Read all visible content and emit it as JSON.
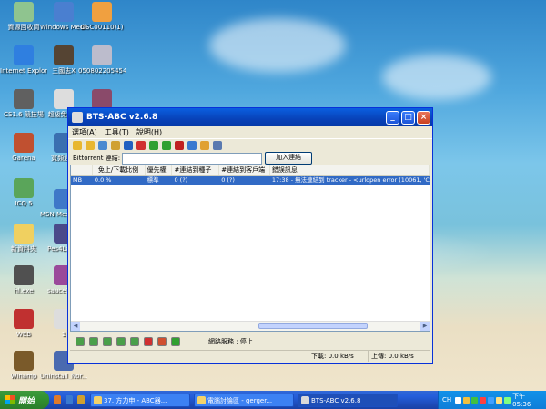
{
  "desktop": {
    "icons": [
      {
        "label": "資源回收筒",
        "color": "#8fc48f"
      },
      {
        "label": "Windows Media Player",
        "color": "#4a7fd0"
      },
      {
        "label": "DSC00110(1)",
        "color": "#f0a040"
      },
      {
        "label": "Internet Explorer",
        "color": "#2f7fe0"
      },
      {
        "label": "三國志X",
        "color": "#554433"
      },
      {
        "label": "050802205454",
        "color": "#bcbccc"
      },
      {
        "label": "CS1.6 競技場",
        "color": "#606060"
      },
      {
        "label": "超級免子...",
        "color": "#dddddd"
      },
      {
        "label": "",
        "color": "#8a4a6a"
      },
      {
        "label": "Garena",
        "color": "#c05030"
      },
      {
        "label": "寬頻連...",
        "color": "#3a6fb0"
      },
      {
        "label": "ICQ 5",
        "color": "#5aa55a"
      },
      {
        "label": "MSN Messenger",
        "color": "#3e78c8"
      },
      {
        "label": "新資料夾",
        "color": "#f0d060"
      },
      {
        "label": "Pes4Lan...",
        "color": "#4a4a8a"
      },
      {
        "label": "hl.exe",
        "color": "#505050"
      },
      {
        "label": "sauce10...",
        "color": "#9a4a9a"
      },
      {
        "label": "WEB",
        "color": "#c03030"
      },
      {
        "label": "1",
        "color": "#dddddd"
      },
      {
        "label": "Winamp",
        "color": "#7a5a2a"
      },
      {
        "label": "Uninstall_Nor...",
        "color": "#4a6ab0"
      }
    ]
  },
  "window": {
    "title": "BTS-ABC v2.6.8",
    "controls": {
      "minimize": "_",
      "maximize": "□",
      "close": "×"
    },
    "menu": [
      "選項(A)",
      "工具(T)",
      "說明(H)"
    ],
    "toolbar_icons": [
      {
        "name": "open-folder-icon",
        "color": "#e8b730"
      },
      {
        "name": "open-url-icon",
        "color": "#e8b730"
      },
      {
        "name": "add-icon",
        "color": "#4a8ad0"
      },
      {
        "name": "settings-icon",
        "color": "#d0a030"
      },
      {
        "name": "web-icon",
        "color": "#2060c0"
      },
      {
        "name": "stop-icon",
        "color": "#d03030"
      },
      {
        "name": "start-icon",
        "color": "#30a030"
      },
      {
        "name": "pause-icon",
        "color": "#30a030"
      },
      {
        "name": "delete-icon",
        "color": "#c02020"
      },
      {
        "name": "link-icon",
        "color": "#3a7ad0"
      },
      {
        "name": "refresh-icon",
        "color": "#e0a030"
      },
      {
        "name": "list-icon",
        "color": "#5a7ab0"
      }
    ],
    "url_row": {
      "label": "Bittorrent 連結:",
      "value": "",
      "button": "加入連結"
    },
    "columns": [
      "",
      "免上/下載比例",
      "優先權",
      "#連結到種子",
      "#連結到客戶端",
      "錯誤訊息"
    ],
    "rows": [
      [
        "MB",
        "0.0 %",
        "標準",
        "0 (?)",
        "0 (?)",
        "17:38 - 無法連結到 tracker - <urlopen error (10061, 'Conn..."
      ]
    ],
    "bottom_buttons": [
      {
        "name": "move-top-icon",
        "color": "#4aa04a"
      },
      {
        "name": "move-up-icon",
        "color": "#4aa04a"
      },
      {
        "name": "move-up-one-icon",
        "color": "#4aa04a"
      },
      {
        "name": "move-down-one-icon",
        "color": "#4aa04a"
      },
      {
        "name": "move-down-icon",
        "color": "#4aa04a"
      },
      {
        "name": "remove-icon",
        "color": "#d03030"
      },
      {
        "name": "stop-all-icon",
        "color": "#d05030"
      },
      {
        "name": "resume-icon",
        "color": "#30a030"
      }
    ],
    "network_status": "網路服務 : 停止",
    "status": {
      "download": "下載: 0.0 kB/s",
      "upload": "上傳: 0.0 kB/s"
    }
  },
  "taskbar": {
    "start_label": "開始",
    "quick_launch": [
      "#e07a2a",
      "#3a7ad0",
      "#d0a030"
    ],
    "tasks": [
      {
        "label": "37. 方力申 - ABC器...",
        "active": false
      },
      {
        "label": "電腦討論區 - gerger...",
        "active": false
      },
      {
        "label": "BTS-ABC v2.6.8",
        "active": true
      }
    ],
    "tray": {
      "lang": "CH",
      "clock": "下午 05:36",
      "icons": [
        "#fff",
        "#f0c040",
        "#40c040",
        "#ff4040",
        "#40a0ff",
        "#ffe080",
        "#80ff80"
      ]
    }
  }
}
